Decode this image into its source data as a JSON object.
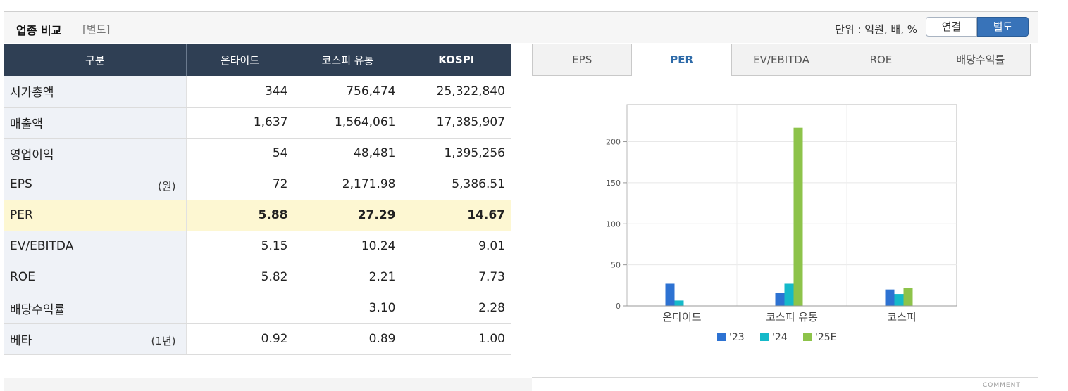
{
  "header": {
    "title": "업종 비교",
    "subtitle": "[별도]",
    "unit": "단위 : 억원, 배, %",
    "toggle": [
      "연결",
      "별도"
    ],
    "toggle_selected": "별도"
  },
  "table": {
    "columns": [
      "구분",
      "온타이드",
      "코스피 유통",
      "KOSPI"
    ],
    "rows": [
      {
        "label": "시가총액",
        "unit": "",
        "values": [
          "344",
          "756,474",
          "25,322,840"
        ]
      },
      {
        "label": "매출액",
        "unit": "",
        "values": [
          "1,637",
          "1,564,061",
          "17,385,907"
        ]
      },
      {
        "label": "영업이익",
        "unit": "",
        "values": [
          "54",
          "48,481",
          "1,395,256"
        ]
      },
      {
        "label": "EPS",
        "unit": "(원)",
        "values": [
          "72",
          "2,171.98",
          "5,386.51"
        ]
      },
      {
        "label": "PER",
        "unit": "",
        "values": [
          "5.88",
          "27.29",
          "14.67"
        ],
        "highlight": true
      },
      {
        "label": "EV/EBITDA",
        "unit": "",
        "values": [
          "5.15",
          "10.24",
          "9.01"
        ]
      },
      {
        "label": "ROE",
        "unit": "",
        "values": [
          "5.82",
          "2.21",
          "7.73"
        ]
      },
      {
        "label": "배당수익률",
        "unit": "",
        "values": [
          "",
          "3.10",
          "2.28"
        ]
      },
      {
        "label": "베타",
        "unit": "(1년)",
        "values": [
          "0.92",
          "0.89",
          "1.00"
        ]
      }
    ]
  },
  "tabs": [
    "EPS",
    "PER",
    "EV/EBITDA",
    "ROE",
    "배당수익률"
  ],
  "active_tab": "PER",
  "colors": {
    "s23": "#2d72d2",
    "s24": "#15b9c9",
    "s25": "#8dc34a"
  },
  "chart_data": {
    "type": "bar",
    "categories": [
      "온타이드",
      "코스피  유통",
      "코스피"
    ],
    "series": [
      {
        "name": "'23",
        "values": [
          27,
          15.5,
          20
        ]
      },
      {
        "name": "'24",
        "values": [
          6.5,
          27,
          14.5
        ]
      },
      {
        "name": "'25E",
        "values": [
          0,
          217,
          21.5
        ]
      }
    ],
    "yticks": [
      "0",
      "50",
      "100",
      "150",
      "200"
    ],
    "ylim": [
      0,
      245
    ],
    "grid": true,
    "legend": "bottom"
  },
  "footer": {
    "comment": "COMMENT"
  }
}
